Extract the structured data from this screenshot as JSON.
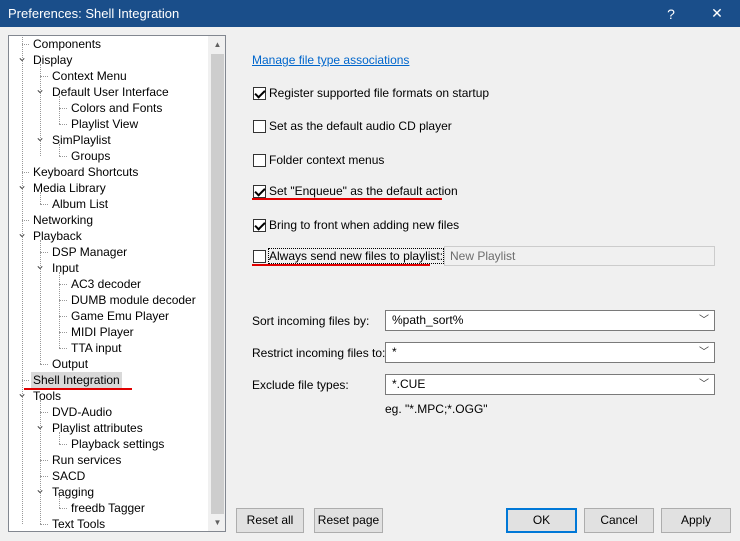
{
  "window": {
    "title": "Preferences: Shell Integration",
    "help_glyph": "?",
    "close_glyph": "✕"
  },
  "tree": {
    "items": [
      {
        "label": "Components",
        "level": 0,
        "expander": ""
      },
      {
        "label": "Display",
        "level": 0,
        "expander": "down"
      },
      {
        "label": "Context Menu",
        "level": 1,
        "expander": ""
      },
      {
        "label": "Default User Interface",
        "level": 1,
        "expander": "down"
      },
      {
        "label": "Colors and Fonts",
        "level": 2,
        "expander": ""
      },
      {
        "label": "Playlist View",
        "level": 2,
        "expander": ""
      },
      {
        "label": "SimPlaylist",
        "level": 1,
        "expander": "down"
      },
      {
        "label": "Groups",
        "level": 2,
        "expander": ""
      },
      {
        "label": "Keyboard Shortcuts",
        "level": 0,
        "expander": ""
      },
      {
        "label": "Media Library",
        "level": 0,
        "expander": "down"
      },
      {
        "label": "Album List",
        "level": 1,
        "expander": ""
      },
      {
        "label": "Networking",
        "level": 0,
        "expander": ""
      },
      {
        "label": "Playback",
        "level": 0,
        "expander": "down"
      },
      {
        "label": "DSP Manager",
        "level": 1,
        "expander": ""
      },
      {
        "label": "Input",
        "level": 1,
        "expander": "down"
      },
      {
        "label": "AC3 decoder",
        "level": 2,
        "expander": ""
      },
      {
        "label": "DUMB module decoder",
        "level": 2,
        "expander": ""
      },
      {
        "label": "Game Emu Player",
        "level": 2,
        "expander": ""
      },
      {
        "label": "MIDI Player",
        "level": 2,
        "expander": ""
      },
      {
        "label": "TTA input",
        "level": 2,
        "expander": ""
      },
      {
        "label": "Output",
        "level": 1,
        "expander": ""
      },
      {
        "label": "Shell Integration",
        "level": 0,
        "expander": "",
        "selected": true
      },
      {
        "label": "Tools",
        "level": 0,
        "expander": "down"
      },
      {
        "label": "DVD-Audio",
        "level": 1,
        "expander": ""
      },
      {
        "label": "Playlist attributes",
        "level": 1,
        "expander": "down"
      },
      {
        "label": "Playback settings",
        "level": 2,
        "expander": ""
      },
      {
        "label": "Run services",
        "level": 1,
        "expander": ""
      },
      {
        "label": "SACD",
        "level": 1,
        "expander": ""
      },
      {
        "label": "Tagging",
        "level": 1,
        "expander": "down"
      },
      {
        "label": "freedb Tagger",
        "level": 2,
        "expander": ""
      },
      {
        "label": "Text Tools",
        "level": 1,
        "expander": ""
      }
    ]
  },
  "panel": {
    "manage_link": "Manage file type associations",
    "checkboxes": [
      {
        "label": "Register supported file formats on startup",
        "checked": true
      },
      {
        "label": "Set as the default audio CD player",
        "checked": false
      },
      {
        "label": "Folder context menus",
        "checked": false
      },
      {
        "label": "Set \"Enqueue\" as the default action",
        "checked": true
      },
      {
        "label": "Bring to front when adding new files",
        "checked": true
      },
      {
        "label": "Always send new files to playlist:",
        "checked": false
      }
    ],
    "playlist_field": "New Playlist",
    "sort_label": "Sort incoming files by:",
    "sort_value": "%path_sort%",
    "restrict_label": "Restrict incoming files to:",
    "restrict_value": "*",
    "exclude_label": "Exclude file types:",
    "exclude_value": "*.CUE",
    "exclude_hint": "eg. \"*.MPC;*.OGG\""
  },
  "buttons": {
    "reset_all": "Reset all",
    "reset_page": "Reset page",
    "ok": "OK",
    "cancel": "Cancel",
    "apply": "Apply"
  },
  "colors": {
    "titlebar": "#1a4e8a",
    "annotation_red": "#e00000",
    "link": "#0066cc",
    "default_button_border": "#0078d7"
  }
}
